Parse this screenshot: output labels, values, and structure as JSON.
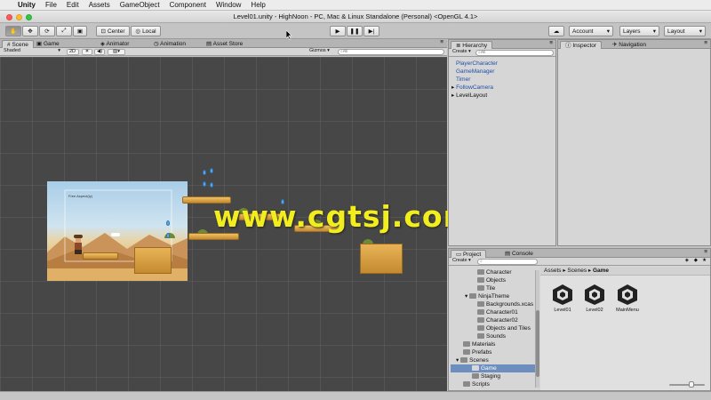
{
  "menubar": {
    "app": "Unity",
    "items": [
      "File",
      "Edit",
      "Assets",
      "GameObject",
      "Component",
      "Window",
      "Help"
    ]
  },
  "window": {
    "title": "Level01.unity - HighNoon - PC, Mac & Linux Standalone (Personal) <OpenGL 4.1>"
  },
  "toolbar": {
    "pivot_label": "Center",
    "space_label": "Local",
    "account_label": "Account",
    "layers_label": "Layers",
    "layout_label": "Layout"
  },
  "scene": {
    "tabs": [
      "Scene",
      "Game",
      "Animator",
      "Animation",
      "Asset Store"
    ],
    "shading_mode": "Shaded",
    "mode_2d": "2D",
    "gizmos_label": "Gizmos",
    "search_placeholder": "All",
    "game_view_label": "Free Aspect(ty)"
  },
  "hierarchy": {
    "tab": "Hierarchy",
    "create_label": "Create",
    "search_placeholder": "All",
    "items": [
      "PlayerCharacter",
      "GameManager",
      "Timer",
      "FollowCamera",
      "LevelLayout"
    ]
  },
  "inspector": {
    "tabs": [
      "Inspector",
      "Navigation"
    ]
  },
  "project": {
    "tabs": [
      "Project",
      "Console"
    ],
    "create_label": "Create",
    "tree": [
      "Character",
      "Objects",
      "Tile",
      "NinjaTheme",
      "Backgrounds.xcas",
      "Character01",
      "Character02",
      "Objects and Tiles",
      "Sounds",
      "Materials",
      "Prefabs",
      "Scenes",
      "Game",
      "Staging",
      "Scripts"
    ],
    "breadcrumb": [
      "Assets",
      "Scenes",
      "Game"
    ],
    "assets": [
      "Level01",
      "Level02",
      "MainMenu"
    ]
  },
  "watermark": "www.cgtsj.com",
  "colors": {
    "scene_bg": "#474747",
    "selection": "#6d8fbf",
    "watermark": "#f2ee1e",
    "hierarchy_link": "#1f4fa8"
  }
}
